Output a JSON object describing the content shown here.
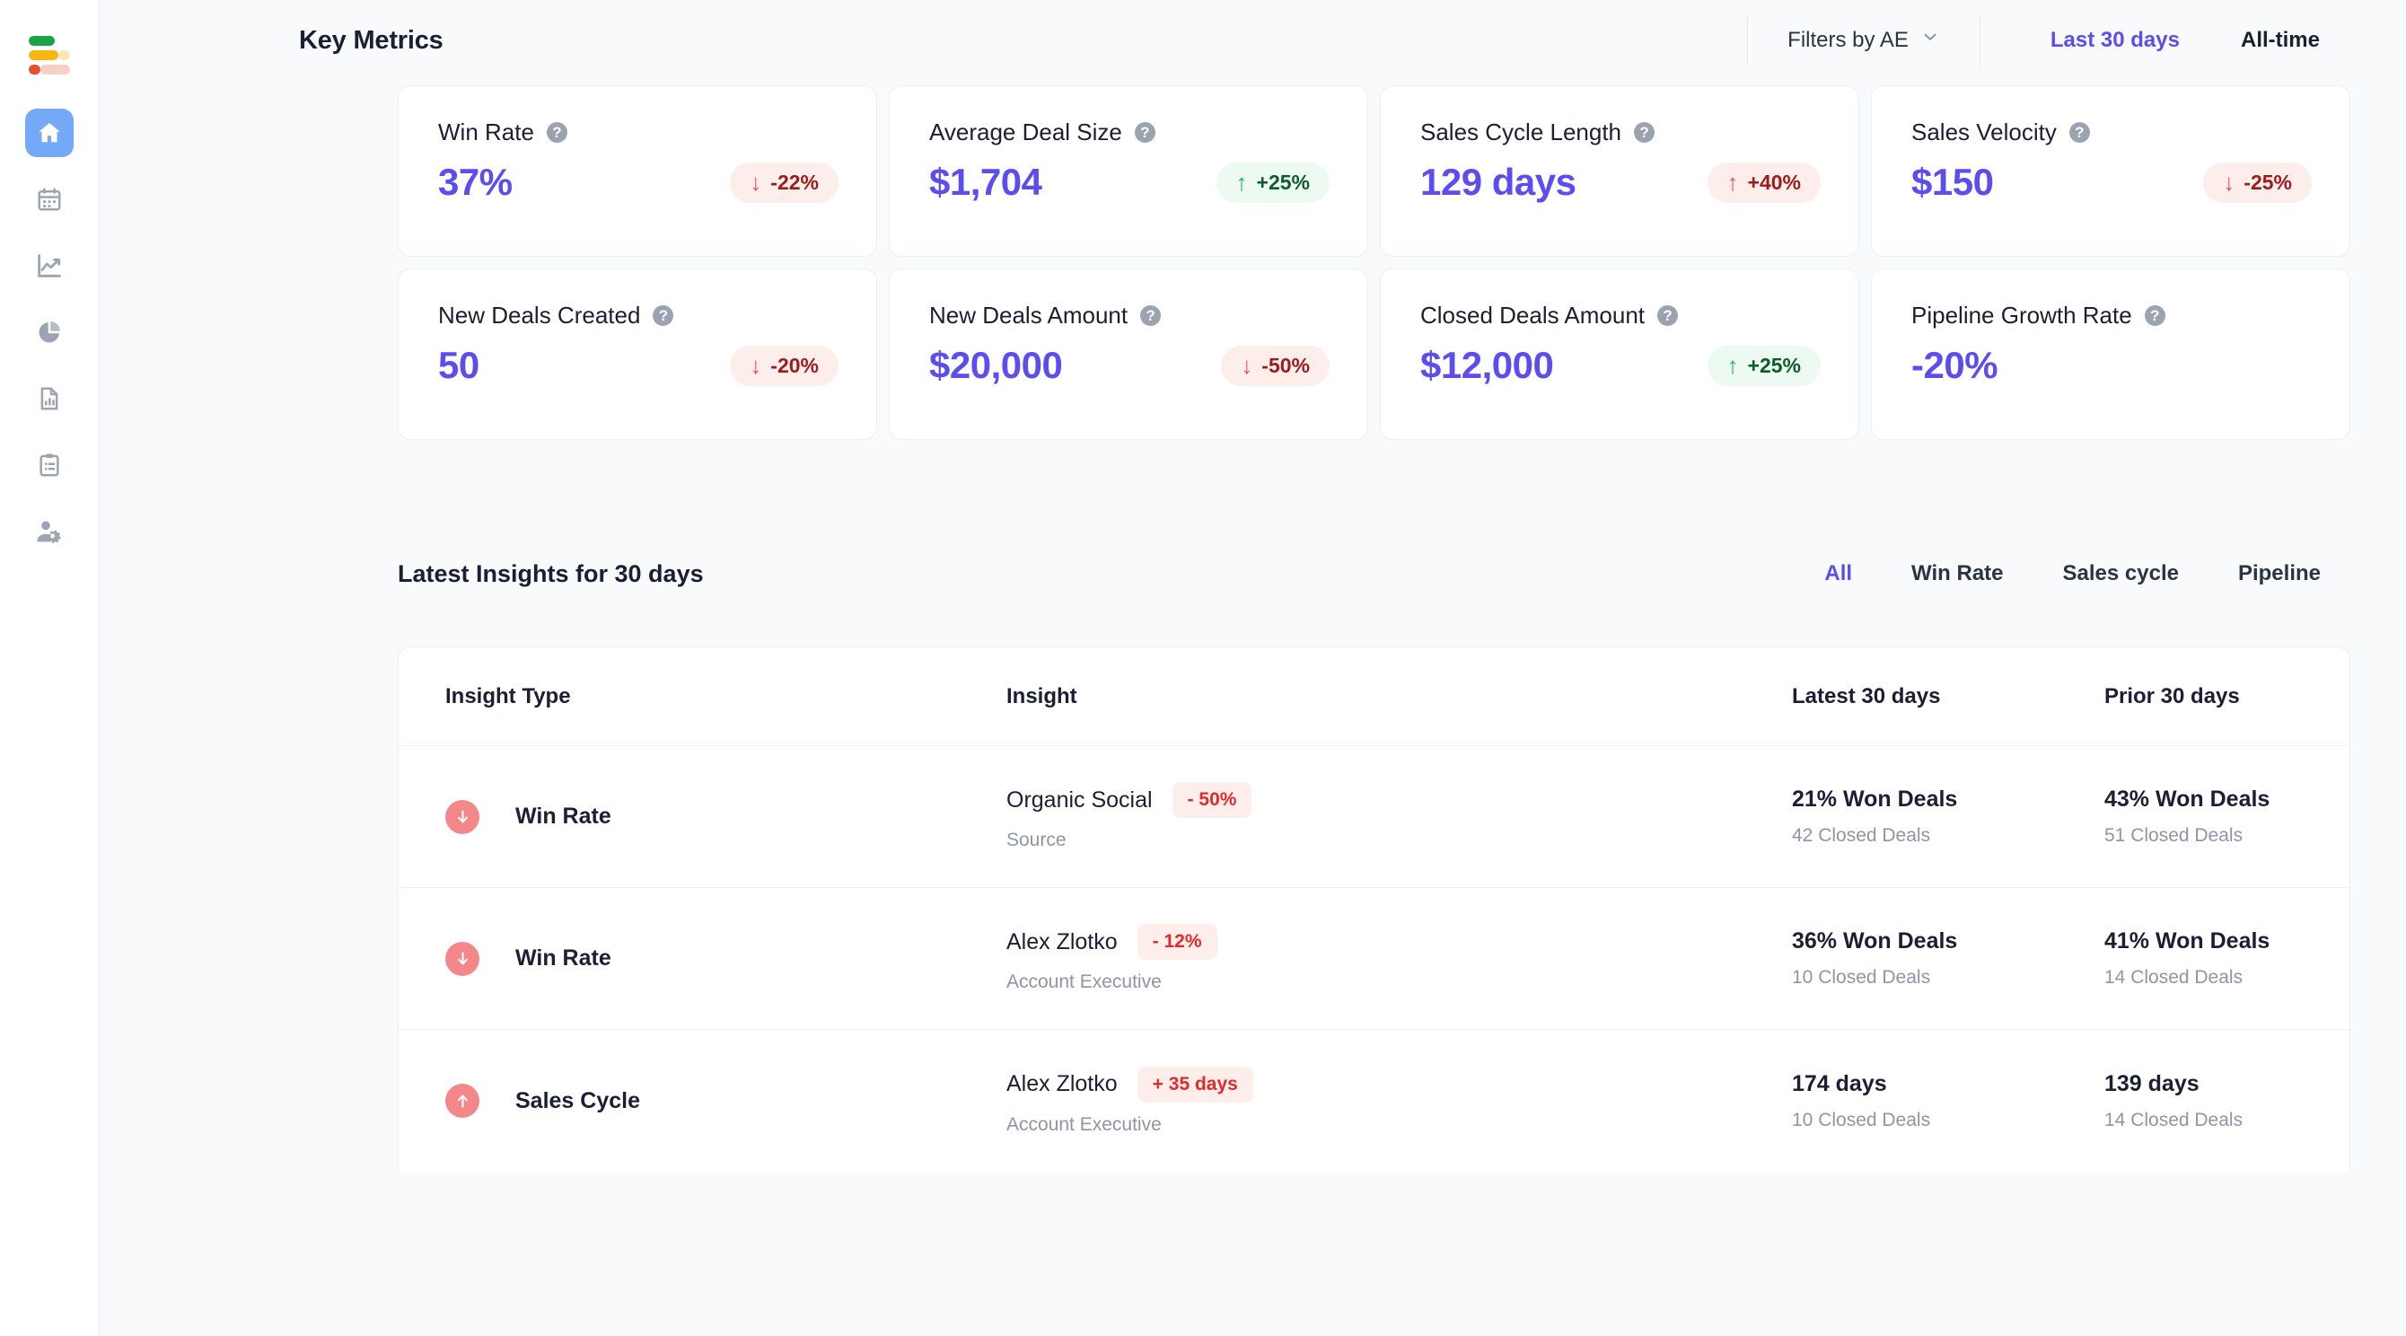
{
  "colors": {
    "accent": "#5b4def",
    "positive": "#0c5c2c",
    "positive_bg": "#edfaf1",
    "negative": "#9c1c1c",
    "negative_bg": "#fdeeec",
    "sidebar_active": "#74a9f7",
    "row_icon": "#f4878a",
    "logo_green": "#1aa545",
    "logo_yellow": "#f9b511",
    "logo_red": "#e8502c"
  },
  "sidebar": {
    "logo_name": "app-logo",
    "items": [
      {
        "icon": "home-icon",
        "name": "sidebar-item-home",
        "active": true
      },
      {
        "icon": "calendar-icon",
        "name": "sidebar-item-calendar",
        "active": false
      },
      {
        "icon": "trending-chart-icon",
        "name": "sidebar-item-trends",
        "active": false
      },
      {
        "icon": "pie-chart-icon",
        "name": "sidebar-item-breakdown",
        "active": false
      },
      {
        "icon": "document-chart-icon",
        "name": "sidebar-item-reports",
        "active": false
      },
      {
        "icon": "clipboard-list-icon",
        "name": "sidebar-item-tasks",
        "active": false
      },
      {
        "icon": "user-settings-icon",
        "name": "sidebar-item-team-settings",
        "active": false
      }
    ]
  },
  "header": {
    "title": "Key Metrics",
    "filter_label": "Filters by AE",
    "filter_icon": "chevron-down-icon",
    "ranges": [
      {
        "label": "Last 30 days",
        "active": true
      },
      {
        "label": "All-time",
        "active": false
      }
    ]
  },
  "metrics": [
    {
      "title": "Win Rate",
      "value": "37%",
      "badge": "-22%",
      "direction": "down",
      "tone": "neg"
    },
    {
      "title": "Average Deal Size",
      "value": "$1,704",
      "badge": "+25%",
      "direction": "up",
      "tone": "pos"
    },
    {
      "title": "Sales Cycle Length",
      "value": "129 days",
      "badge": "+40%",
      "direction": "up",
      "tone": "neg"
    },
    {
      "title": "Sales Velocity",
      "value": "$150",
      "badge": "-25%",
      "direction": "down",
      "tone": "neg"
    },
    {
      "title": "New Deals Created",
      "value": "50",
      "badge": "-20%",
      "direction": "down",
      "tone": "neg"
    },
    {
      "title": "New Deals Amount",
      "value": "$20,000",
      "badge": "-50%",
      "direction": "down",
      "tone": "neg"
    },
    {
      "title": "Closed Deals Amount",
      "value": "$12,000",
      "badge": "+25%",
      "direction": "up",
      "tone": "pos"
    },
    {
      "title": "Pipeline Growth Rate",
      "value": "-20%",
      "badge": "",
      "direction": "",
      "tone": ""
    }
  ],
  "insights": {
    "title": "Latest Insights for 30 days",
    "tabs": [
      {
        "label": "All",
        "active": true
      },
      {
        "label": "Win Rate",
        "active": false
      },
      {
        "label": "Sales cycle",
        "active": false
      },
      {
        "label": "Pipeline",
        "active": false
      }
    ],
    "columns": {
      "type": "Insight Type",
      "insight": "Insight",
      "latest": "Latest 30 days",
      "prior": "Prior 30 days"
    },
    "rows": [
      {
        "icon": "arrow-down-circle-icon",
        "direction": "down",
        "type": "Win Rate",
        "name": "Organic Social",
        "badge": "- 50%",
        "sub": "Source",
        "latest_main": "21% Won Deals",
        "latest_sub": "42 Closed Deals",
        "prior_main": "43% Won Deals",
        "prior_sub": "51 Closed Deals"
      },
      {
        "icon": "arrow-down-circle-icon",
        "direction": "down",
        "type": "Win Rate",
        "name": "Alex Zlotko",
        "badge": "- 12%",
        "sub": "Account Executive",
        "latest_main": "36% Won Deals",
        "latest_sub": "10 Closed Deals",
        "prior_main": "41% Won Deals",
        "prior_sub": "14 Closed Deals"
      },
      {
        "icon": "arrow-up-circle-icon",
        "direction": "up",
        "type": "Sales Cycle",
        "name": "Alex Zlotko",
        "badge": "+ 35 days",
        "sub": "Account Executive",
        "latest_main": "174 days",
        "latest_sub": "10 Closed Deals",
        "prior_main": "139 days",
        "prior_sub": "14 Closed Deals"
      }
    ]
  }
}
